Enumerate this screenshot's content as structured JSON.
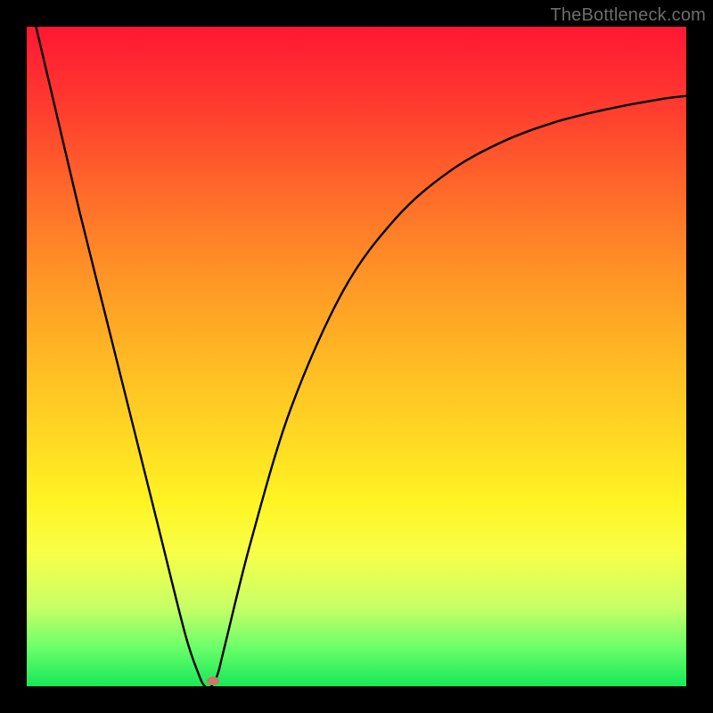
{
  "watermark": "TheBottleneck.com",
  "chart_data": {
    "type": "line",
    "title": "",
    "xlabel": "",
    "ylabel": "",
    "xlim": [
      0,
      100
    ],
    "ylim": [
      0,
      100
    ],
    "grid": false,
    "series": [
      {
        "name": "curve",
        "x": [
          0,
          4,
          8,
          12,
          16,
          20,
          24,
          26,
          27,
          28,
          29,
          30,
          34,
          40,
          48,
          56,
          64,
          72,
          80,
          88,
          96,
          100
        ],
        "y": [
          106,
          89,
          72,
          56,
          40,
          24,
          8,
          2,
          0,
          0,
          2,
          6,
          22,
          42,
          60,
          71,
          78,
          82.5,
          85.5,
          87.5,
          89,
          89.5
        ]
      }
    ],
    "marker": {
      "x": 28.2,
      "y": 0.8,
      "color": "#c97a6a"
    },
    "background_gradient": {
      "top": "#ff1733",
      "mid": "#ffd823",
      "bottom": "#17e858"
    }
  }
}
